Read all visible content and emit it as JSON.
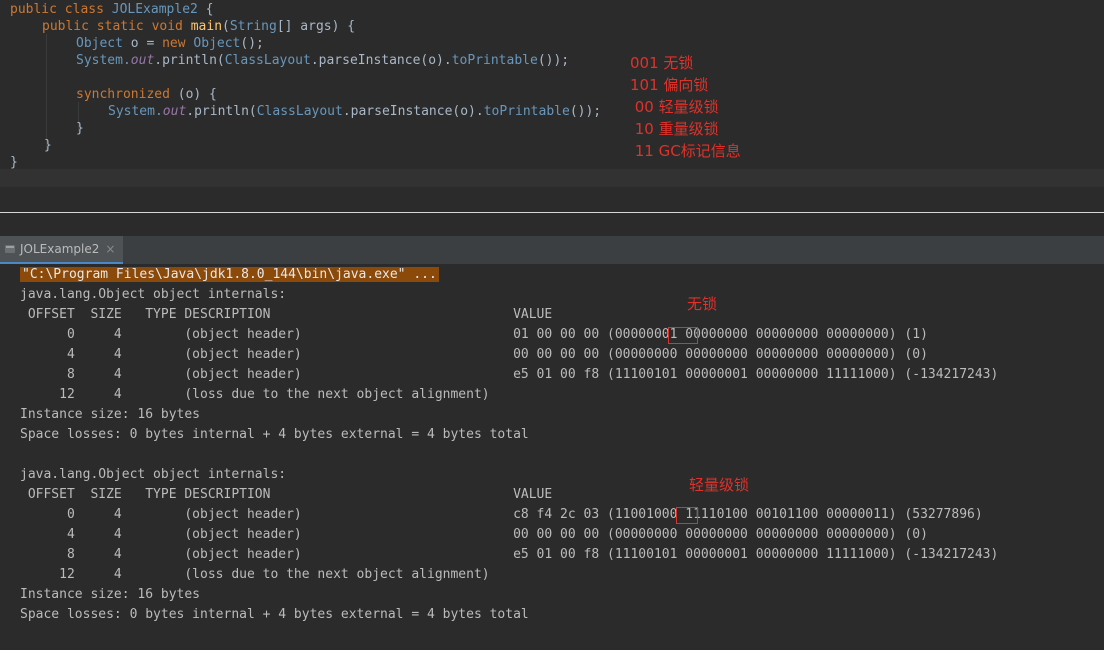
{
  "editor": {
    "line1_kw": "public class ",
    "line1_name": "JOLExample2",
    "line1_end": " {",
    "line2_kw": "public static void ",
    "line2_method": "main",
    "line2_open": "(",
    "line2_type": "String",
    "line2_rest": "[] args) {",
    "line3_type1": "Object",
    "line3_mid": " o = ",
    "line3_new": "new ",
    "line3_type2": "Object",
    "line3_end": "();",
    "line4_sys": "System.",
    "line4_out": "out",
    "line4_println": ".println(",
    "line4_cl": "ClassLayout",
    "line4_parse": ".parseInstance(o).",
    "line4_tp": "toPrintable",
    "line4_end": "());",
    "line5_kw": "synchronized ",
    "line5_rest": "(o) {",
    "line6_sys": "System.",
    "line6_out": "out",
    "line6_println": ".println(",
    "line6_cl": "ClassLayout",
    "line6_parse": ".parseInstance(o).",
    "line6_tp": "toPrintable",
    "line6_end": "());",
    "brace_inner": "}",
    "brace_method": "}",
    "brace_class": "}"
  },
  "annotations": [
    "001 无锁",
    "101 偏向锁",
    " 00 轻量级锁",
    " 10 重量级锁",
    " 11 GC标记信息"
  ],
  "run_tab": {
    "label": "JOLExample2",
    "close": "×"
  },
  "console": {
    "command": "\"C:\\Program Files\\Java\\jdk1.8.0_144\\bin\\java.exe\" ...",
    "block1": {
      "label": "无锁",
      "title": "java.lang.Object object internals:",
      "header": " OFFSET  SIZE   TYPE DESCRIPTION                               VALUE",
      "rows": [
        "      0     4        (object header)                           01 00 00 00 (00000001 00000000 00000000 00000000) (1)",
        "      4     4        (object header)                           00 00 00 00 (00000000 00000000 00000000 00000000) (0)",
        "      8     4        (object header)                           e5 01 00 f8 (11100101 00000001 00000000 11111000) (-134217243)",
        "     12     4        (loss due to the next object alignment)"
      ],
      "instance": "Instance size: 16 bytes",
      "losses": "Space losses: 0 bytes internal + 4 bytes external = 4 bytes total"
    },
    "block2": {
      "label": "轻量级锁",
      "title": "java.lang.Object object internals:",
      "header": " OFFSET  SIZE   TYPE DESCRIPTION                               VALUE",
      "rows": [
        "      0     4        (object header)                           c8 f4 2c 03 (11001000 11110100 00101100 00000011) (53277896)",
        "      4     4        (object header)                           00 00 00 00 (00000000 00000000 00000000 00000000) (0)",
        "      8     4        (object header)                           e5 01 00 f8 (11100101 00000001 00000000 11111000) (-134217243)",
        "     12     4        (loss due to the next object alignment)"
      ],
      "instance": "Instance size: 16 bytes",
      "losses": "Space losses: 0 bytes internal + 4 bytes external = 4 bytes total"
    }
  }
}
